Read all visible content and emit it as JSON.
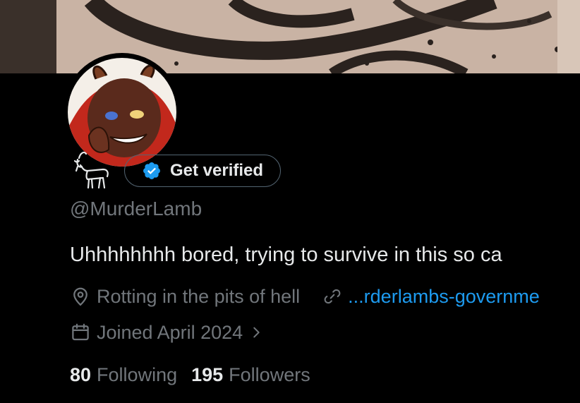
{
  "profile": {
    "handle": "@MurderLamb",
    "verify_label": "Get verified",
    "bio": "Uhhhhhhhh bored, trying to survive in this so ca",
    "location": "Rotting in the pits of hell",
    "website": "...rderlambs-governme",
    "joined": "Joined April 2024",
    "following_count": "80",
    "following_label": "Following",
    "followers_count": "195",
    "followers_label": "Followers"
  },
  "colors": {
    "accent": "#1d9bf0",
    "text_primary": "#e7e9ea",
    "text_secondary": "#71767b",
    "border": "#536471",
    "background": "#000000"
  },
  "icons": {
    "verify": "verified-badge-icon",
    "name": "goat-icon",
    "location": "location-pin-icon",
    "website": "link-icon",
    "joined": "calendar-icon",
    "chevron": "chevron-right-icon"
  }
}
